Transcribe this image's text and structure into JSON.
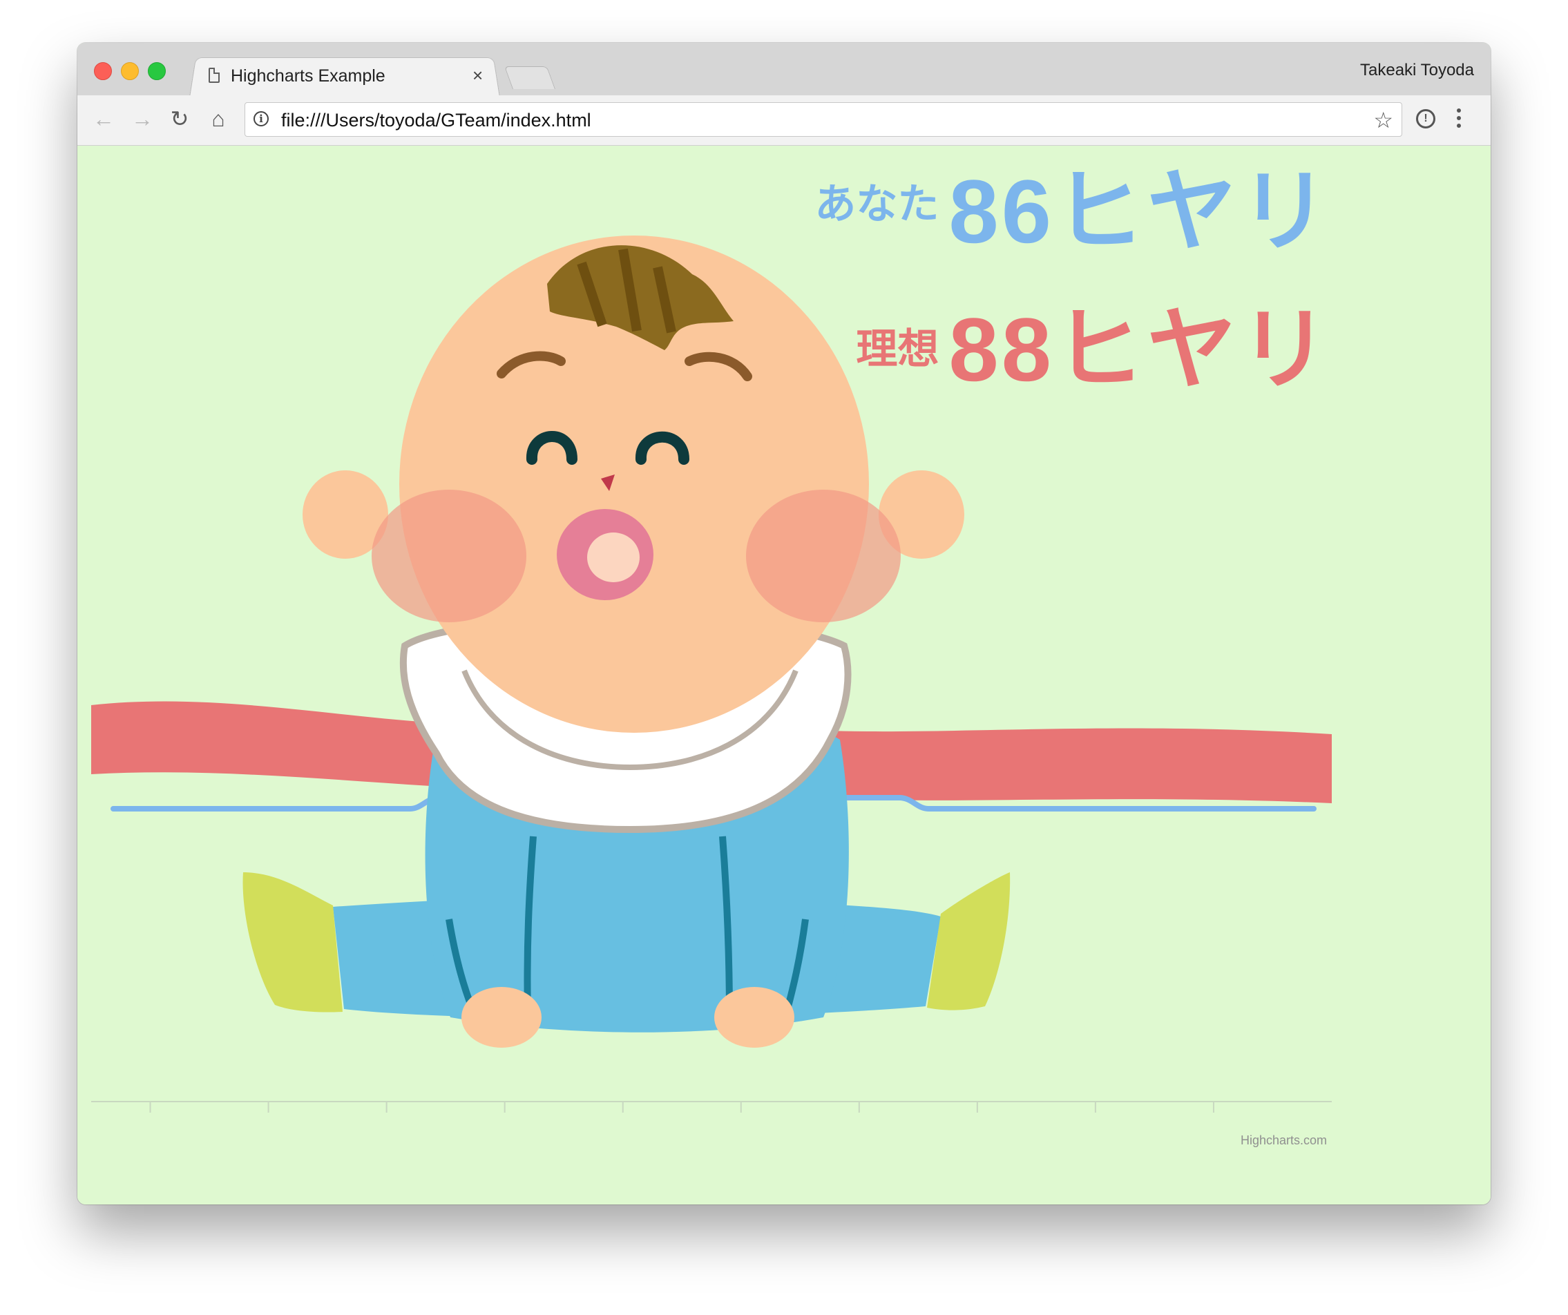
{
  "browser": {
    "tab_title": "Highcharts Example",
    "tab_close": "×",
    "profile_name": "Takeaki Toyoda",
    "url": "file:///Users/toyoda/GTeam/index.html",
    "back": "←",
    "forward": "→",
    "reload": "↻",
    "home": "⌂",
    "star": "☆"
  },
  "page": {
    "you": {
      "prefix": "あなた",
      "value": "86ヒヤリ",
      "color": "#7cb5ec"
    },
    "ideal": {
      "prefix": "理想",
      "value": "88ヒヤリ",
      "color": "#e87575"
    },
    "credit": "Highcharts.com",
    "background": "#dff9d0",
    "illustration": "baby-sitting-illustration"
  },
  "chart_data": {
    "type": "line",
    "series": [
      {
        "color": "#e87575",
        "values": []
      },
      {
        "color": "#7cb5ec",
        "values": []
      }
    ],
    "x_ticks": 10,
    "grid": false
  }
}
